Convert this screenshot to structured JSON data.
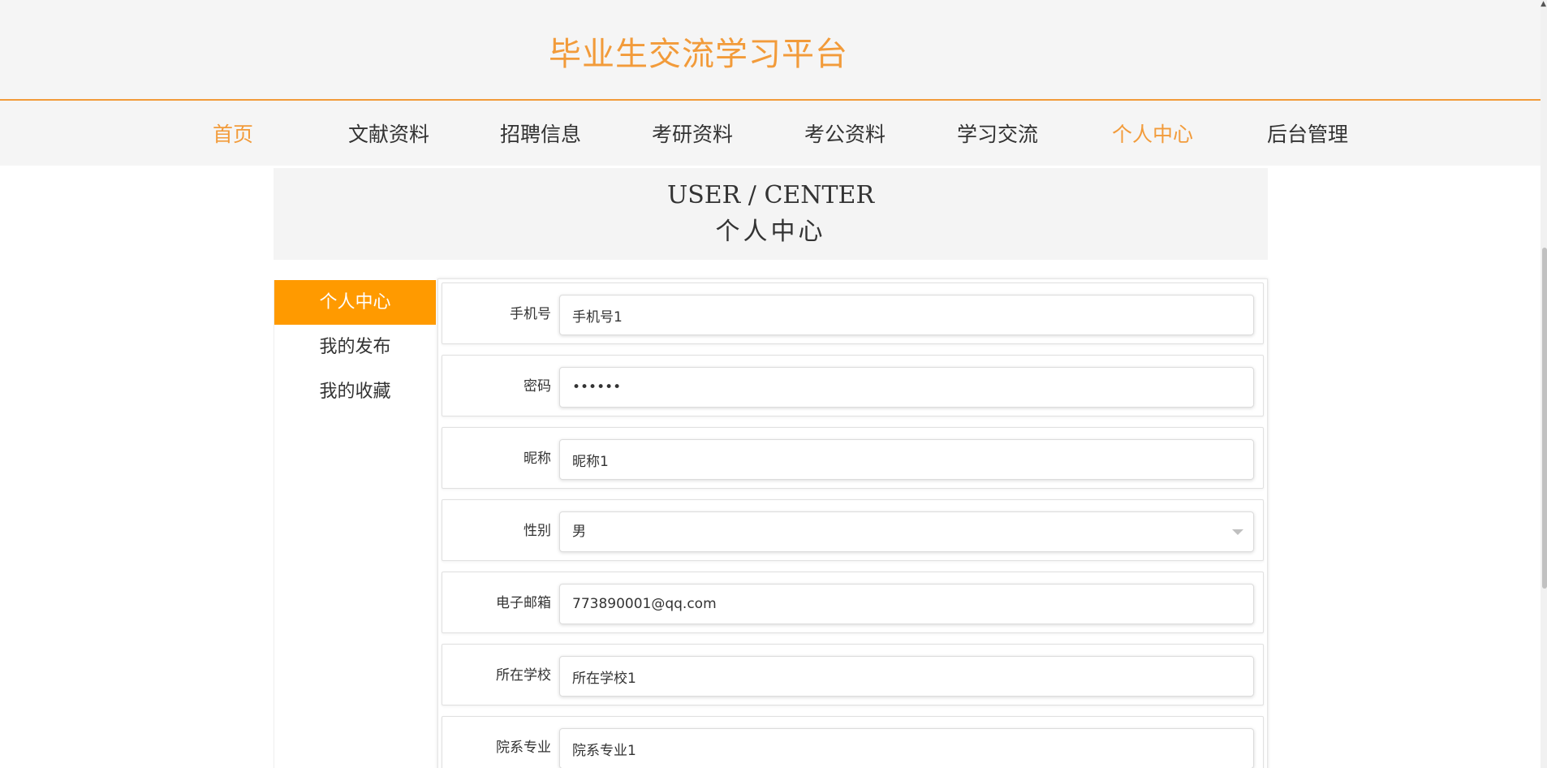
{
  "header": {
    "site_title": "毕业生交流学习平台"
  },
  "nav": {
    "items": [
      {
        "label": "首页",
        "active": true
      },
      {
        "label": "文献资料",
        "active": false
      },
      {
        "label": "招聘信息",
        "active": false
      },
      {
        "label": "考研资料",
        "active": false
      },
      {
        "label": "考公资料",
        "active": false
      },
      {
        "label": "学习交流",
        "active": false
      },
      {
        "label": "个人中心",
        "active": true
      },
      {
        "label": "后台管理",
        "active": false
      }
    ]
  },
  "banner": {
    "title_en": "USER / CENTER",
    "title_cn": "个人中心"
  },
  "sidebar": {
    "items": [
      {
        "label": "个人中心",
        "active": true
      },
      {
        "label": "我的发布",
        "active": false
      },
      {
        "label": "我的收藏",
        "active": false
      }
    ]
  },
  "form": {
    "phone": {
      "label": "手机号",
      "value": "手机号1"
    },
    "password": {
      "label": "密码",
      "value": "••••••"
    },
    "nickname": {
      "label": "昵称",
      "value": "昵称1"
    },
    "gender": {
      "label": "性别",
      "value": "男"
    },
    "email": {
      "label": "电子邮箱",
      "value": "773890001@qq.com"
    },
    "school": {
      "label": "所在学校",
      "value": "所在学校1"
    },
    "major": {
      "label": "院系专业",
      "value": "院系专业1"
    }
  },
  "colors": {
    "accent": "#f29b3a",
    "sidebar_active": "#ff9a00"
  }
}
